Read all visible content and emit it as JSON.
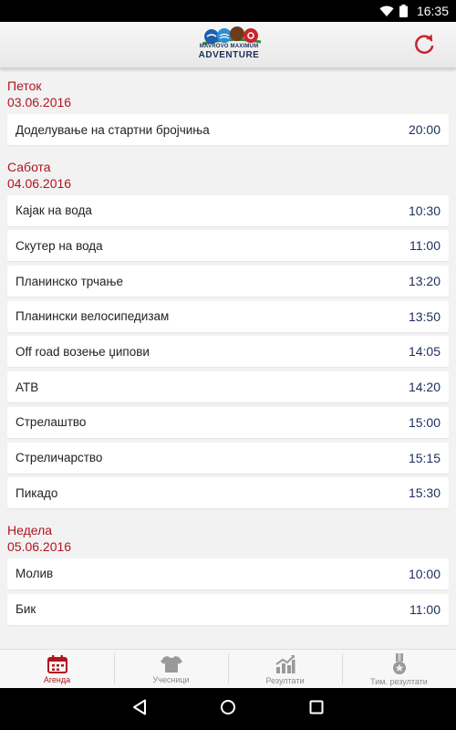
{
  "status_bar": {
    "time": "16:35"
  },
  "app_bar": {
    "logo_small": "MAVROVO MAXIMUM",
    "logo_big": "ADVENTURE"
  },
  "days": [
    {
      "name": "Петок",
      "date": "03.06.2016",
      "events": [
        {
          "name": "Доделување на стартни бројчиња",
          "time": "20:00"
        }
      ]
    },
    {
      "name": "Сабота",
      "date": "04.06.2016",
      "events": [
        {
          "name": "Кајак на вода",
          "time": "10:30"
        },
        {
          "name": "Скутер на вода",
          "time": "11:00"
        },
        {
          "name": "Планинско трчање",
          "time": "13:20"
        },
        {
          "name": "Планински велосипедизам",
          "time": "13:50"
        },
        {
          "name": "Off road возење џипови",
          "time": "14:05"
        },
        {
          "name": "АТВ",
          "time": "14:20"
        },
        {
          "name": "Стрелаштво",
          "time": "15:00"
        },
        {
          "name": "Стреличарство",
          "time": "15:15"
        },
        {
          "name": "Пикадо",
          "time": "15:30"
        }
      ]
    },
    {
      "name": "Недела",
      "date": "05.06.2016",
      "events": [
        {
          "name": "Молив",
          "time": "10:00"
        },
        {
          "name": "Бик",
          "time": "11:00"
        }
      ]
    }
  ],
  "bottom_nav": [
    {
      "label": "Агенда",
      "icon": "calendar-icon",
      "active": true
    },
    {
      "label": "Учесници",
      "icon": "shirt-icon",
      "active": false
    },
    {
      "label": "Резултати",
      "icon": "chart-icon",
      "active": false
    },
    {
      "label": "Тим. резултати",
      "icon": "medal-icon",
      "active": false
    }
  ],
  "colors": {
    "accent": "#b0141e",
    "time_text": "#1f2d5c",
    "background": "#f2f2f2"
  }
}
